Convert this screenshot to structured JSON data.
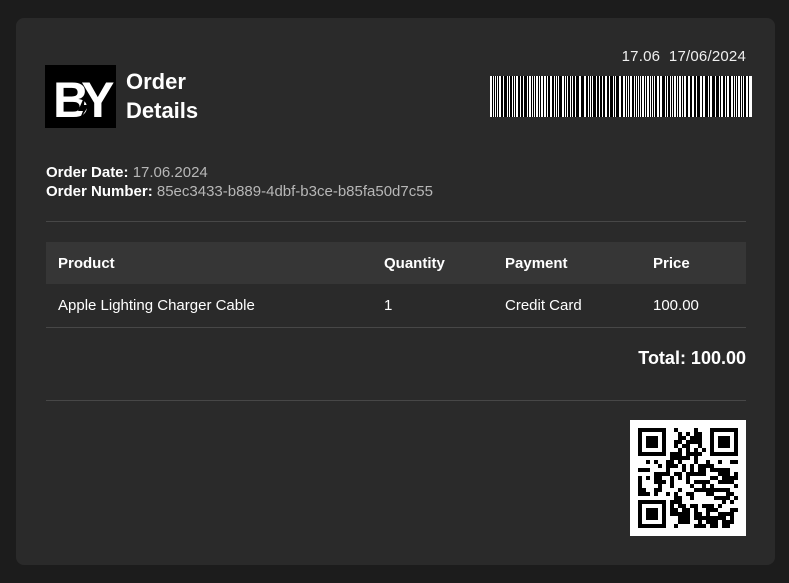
{
  "header": {
    "logo_text": "BY",
    "title": "Order Details",
    "stamp": "17.06  17/06/2024"
  },
  "order": {
    "date_label": "Order Date:",
    "date_value": "17.06.2024",
    "number_label": "Order Number:",
    "number_value": "85ec3433-b889-4dbf-b3ce-b85fa50d7c55"
  },
  "table": {
    "headers": [
      "Product",
      "Quantity",
      "Payment",
      "Price"
    ],
    "rows": [
      [
        "Apple Lighting Charger Cable",
        "1",
        "Credit Card",
        "100.00"
      ]
    ]
  },
  "total": "Total: 100.00",
  "colors": {
    "page_bg": "#1c1c1c",
    "card_bg": "#2a2a2a",
    "header_row_bg": "#363636",
    "muted_text": "#b7b7b7"
  }
}
